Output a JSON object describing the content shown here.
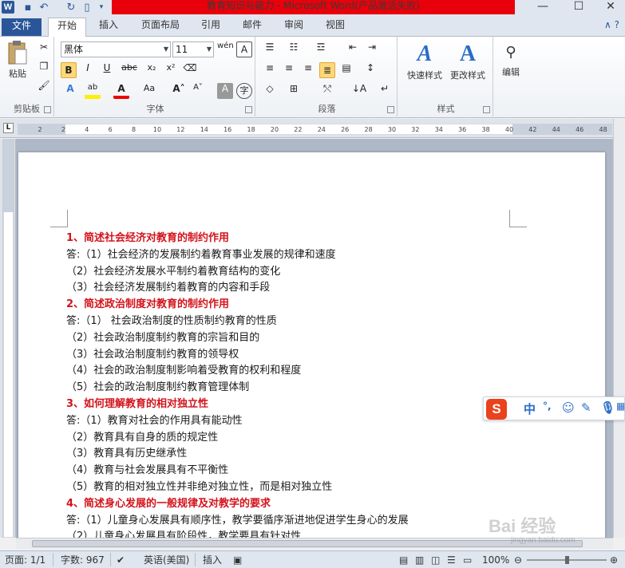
{
  "app": {
    "title": "教育知识与能力  -  Microsoft Word(产品激活失败)",
    "word_icon": "W"
  },
  "tabs": [
    {
      "label": "文件"
    },
    {
      "label": "开始"
    },
    {
      "label": "插入"
    },
    {
      "label": "页面布局"
    },
    {
      "label": "引用"
    },
    {
      "label": "邮件"
    },
    {
      "label": "审阅"
    },
    {
      "label": "视图"
    }
  ],
  "ribbon": {
    "clipboard": {
      "label": "剪贴板",
      "paste": "粘贴"
    },
    "font": {
      "label": "字体",
      "font_name": "黑体",
      "font_size": "11"
    },
    "paragraph": {
      "label": "段落"
    },
    "styles": {
      "label": "样式",
      "quick_styles": "快速样式",
      "change_styles": "更改样式"
    },
    "editing": {
      "label": "编辑"
    }
  },
  "ruler": {
    "corner": "L",
    "ticks": [
      "2",
      "2",
      "4",
      "6",
      "8",
      "10",
      "12",
      "14",
      "16",
      "18",
      "20",
      "22",
      "24",
      "26",
      "28",
      "30",
      "32",
      "34",
      "36",
      "38",
      "40",
      "42",
      "44",
      "46",
      "48"
    ]
  },
  "document": {
    "lines": [
      {
        "text": "1、简述社会经济对教育的制约作用",
        "heading": true
      },
      {
        "text": "答:（1）社会经济的发展制约着教育事业发展的规律和速度",
        "heading": false
      },
      {
        "text": "（2）社会经济发展水平制约着教育结构的变化",
        "heading": false
      },
      {
        "text": "（3）社会经济发展制约着教育的内容和手段",
        "heading": false
      },
      {
        "text": "2、简述政治制度对教育的制约作用",
        "heading": true
      },
      {
        "text": "答:（1）  社会政治制度的性质制约教育的性质",
        "heading": false
      },
      {
        "text": "（2）社会政治制度制约教育的宗旨和目的",
        "heading": false
      },
      {
        "text": "（3）社会政治制度制约教育的领导权",
        "heading": false
      },
      {
        "text": "（4）社会的政治制度制影响着受教育的权利和程度",
        "heading": false
      },
      {
        "text": "（5）社会的政治制度制约教育管理体制",
        "heading": false
      },
      {
        "text": "3、如何理解教育的相对独立性",
        "heading": true
      },
      {
        "text": "答:（1）教育对社会的作用具有能动性",
        "heading": false
      },
      {
        "text": "（2）教育具有自身的质的规定性",
        "heading": false
      },
      {
        "text": "（3）教育具有历史继承性",
        "heading": false
      },
      {
        "text": "（4）教育与社会发展具有不平衡性",
        "heading": false
      },
      {
        "text": "（5）教育的相对独立性并非绝对独立性，而是相对独立性",
        "heading": false
      },
      {
        "text": "4、简述身心发展的一般规律及对教学的要求",
        "heading": true
      },
      {
        "text": "答:（1）儿童身心发展具有顺序性，教学要循序渐进地促进学生身心的发展",
        "heading": false
      },
      {
        "text": "（2）儿童身心发展具有阶段性，教学要具有针对性",
        "heading": false
      }
    ]
  },
  "ime": {
    "logo": "S",
    "mode": "中",
    "punct": "°,"
  },
  "status": {
    "page": "页面: 1/1",
    "words": "字数: 967",
    "lang": "英语(美国)",
    "mode": "插入",
    "zoom": "100%"
  },
  "watermark": {
    "text": "Bai 经验",
    "url": "jingyan.baidu.com"
  },
  "colors": {
    "heading": "#d3131b",
    "file_tab": "#2a5699",
    "title_bg": "#e8000a"
  }
}
